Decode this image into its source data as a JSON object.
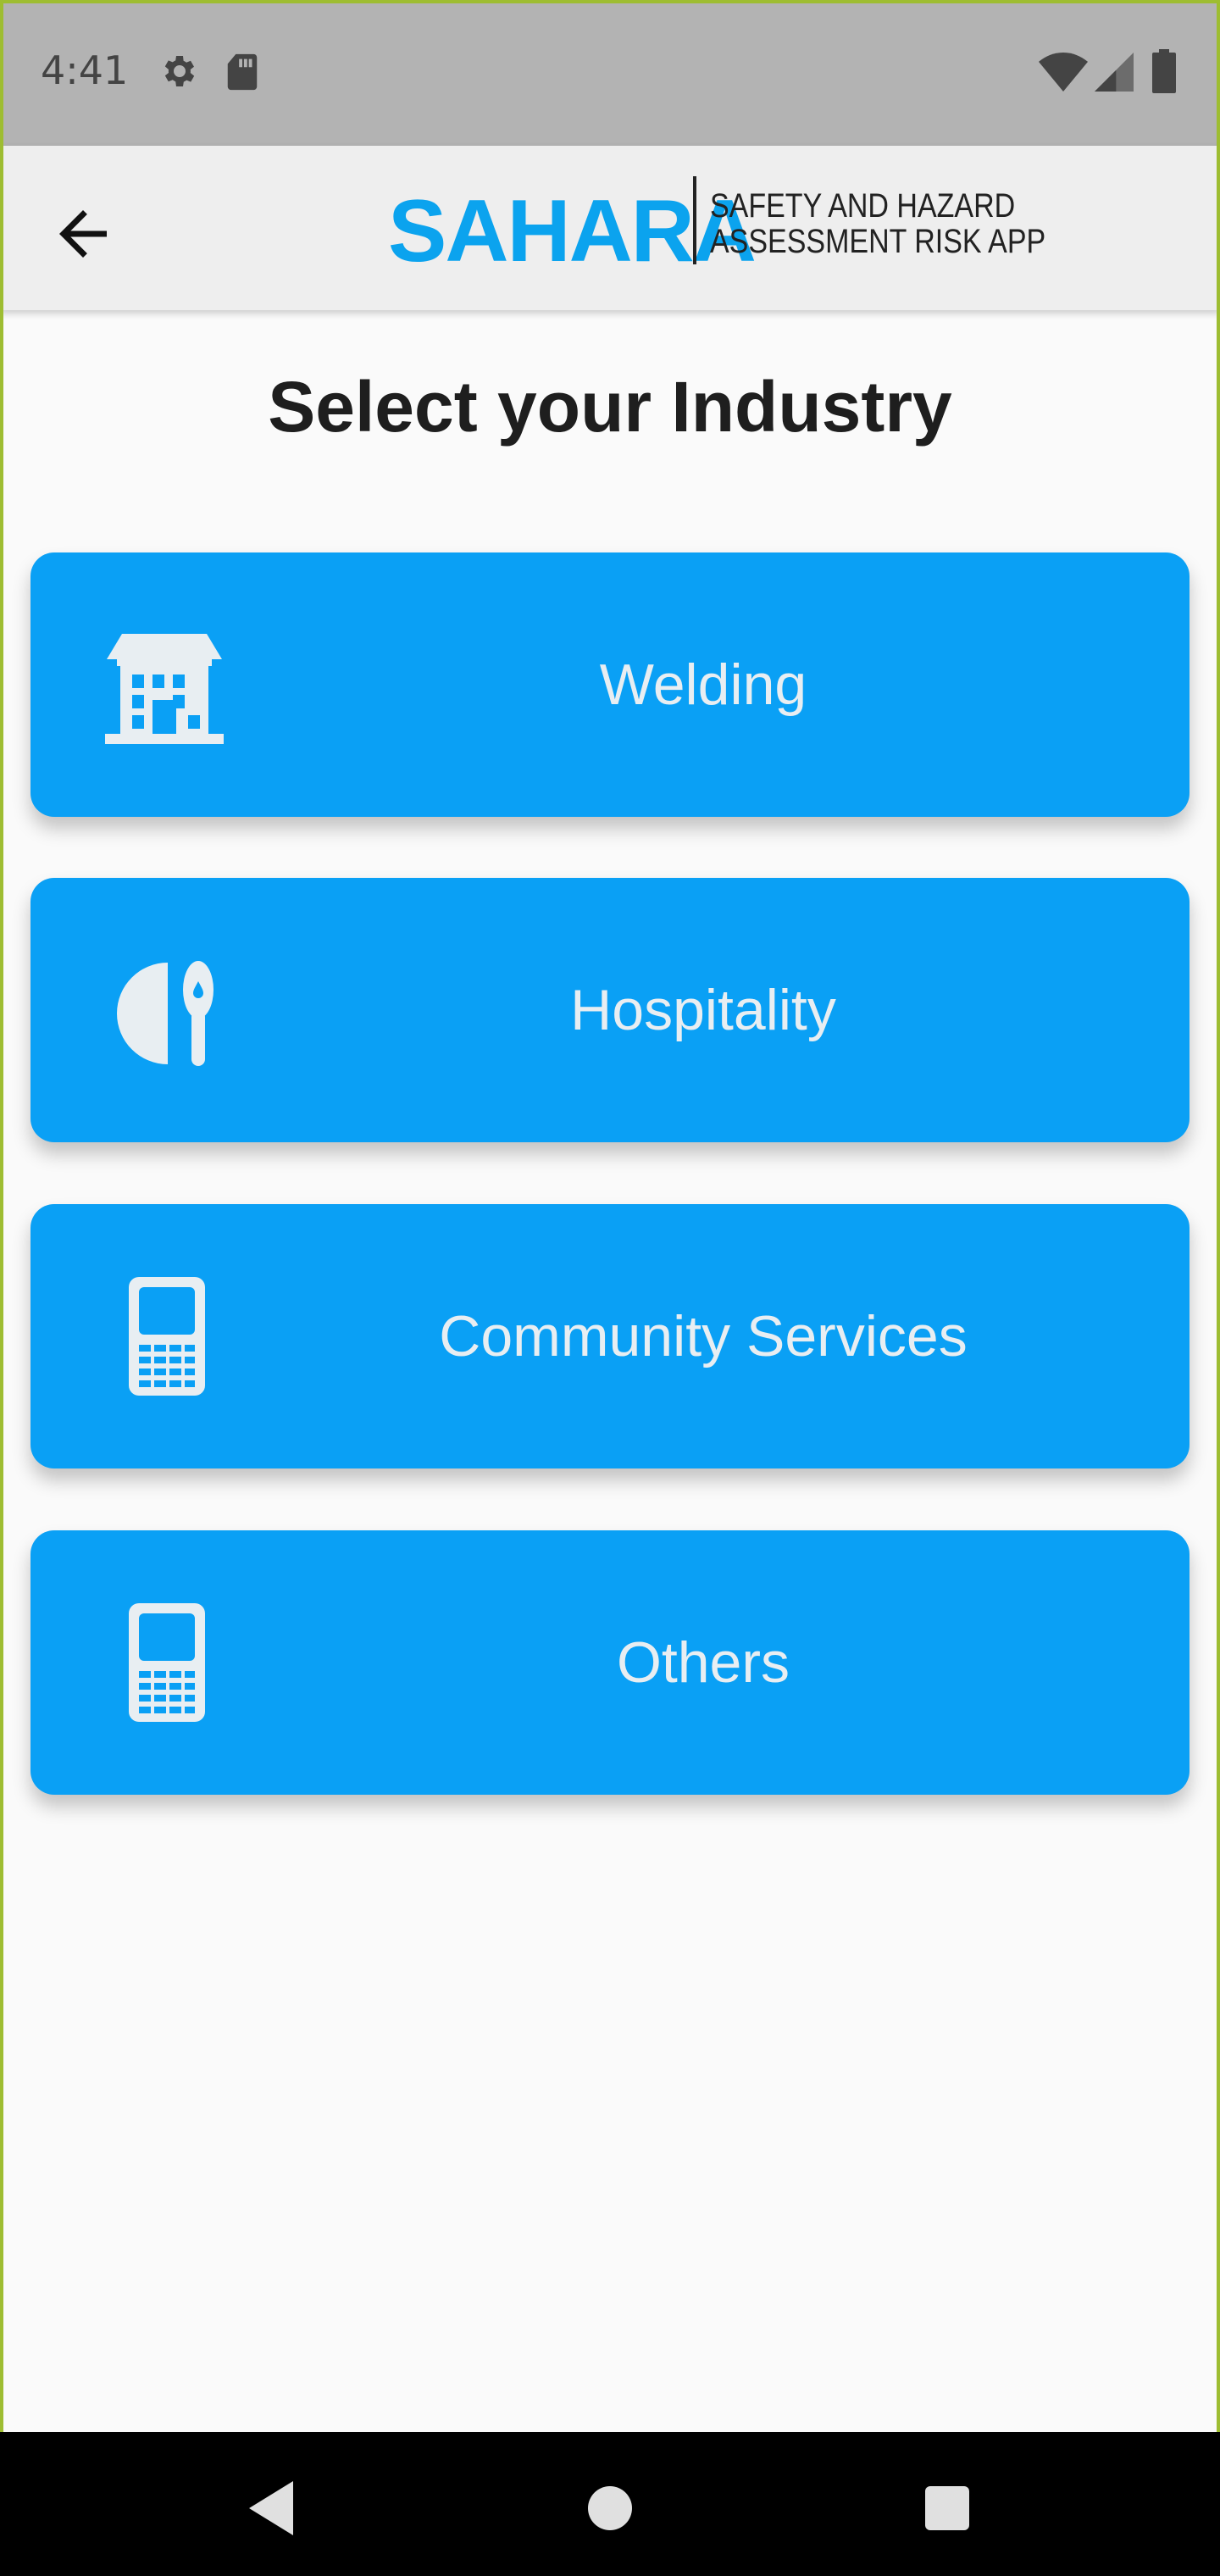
{
  "status_bar": {
    "time": "4:41",
    "icons": [
      "settings-icon",
      "sd-card-icon",
      "wifi-icon",
      "signal-icon",
      "battery-icon"
    ]
  },
  "app_bar": {
    "back_icon": "arrow-left-icon",
    "logo": {
      "wordmark": "SAHARA",
      "tagline_line1": "SAFETY AND HAZARD",
      "tagline_line2": "ASSESSMENT RISK APP"
    }
  },
  "page": {
    "title": "Select your Industry"
  },
  "industries": [
    {
      "label": "Welding",
      "icon": "building-icon"
    },
    {
      "label": "Hospitality",
      "icon": "plate-spoon-icon"
    },
    {
      "label": "Community Services",
      "icon": "mobile-phone-icon"
    },
    {
      "label": "Others",
      "icon": "mobile-phone-icon"
    }
  ],
  "colors": {
    "accent": "#0aa0f5",
    "logo_blue": "#0ba3ee",
    "card_text": "#e8eef2",
    "app_bar_bg": "#eeeeee",
    "status_bar_bg": "#b3b3b3"
  },
  "nav_bar": {
    "buttons": [
      "back-triangle-icon",
      "home-circle-icon",
      "recents-square-icon"
    ]
  }
}
